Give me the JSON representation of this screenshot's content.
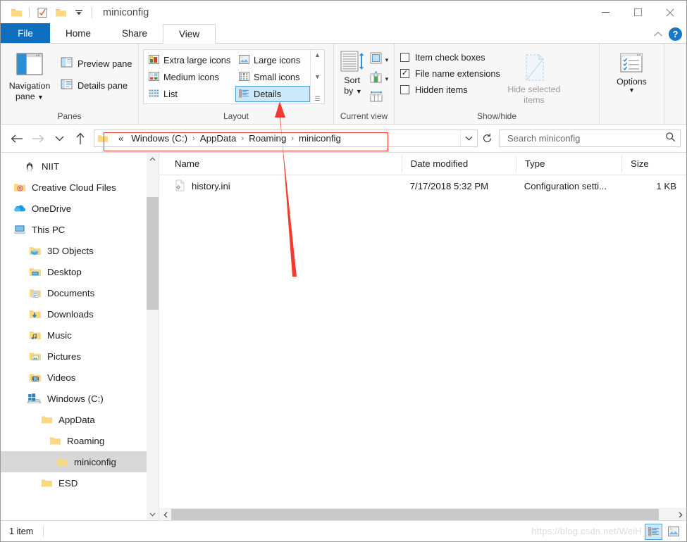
{
  "window": {
    "title": "miniconfig",
    "quick_access": [
      {
        "name": "folder-icon",
        "label": "Folder"
      },
      {
        "name": "properties-icon",
        "label": "Properties"
      },
      {
        "name": "new-folder-icon",
        "label": "New folder"
      },
      {
        "name": "customize-qat-icon",
        "label": "Customize Quick Access Toolbar"
      }
    ],
    "controls": {
      "minimize": "Minimize",
      "maximize": "Maximize",
      "close": "Close"
    }
  },
  "tabs": [
    {
      "label": "File",
      "active": false
    },
    {
      "label": "Home",
      "active": false
    },
    {
      "label": "Share",
      "active": false
    },
    {
      "label": "View",
      "active": true
    }
  ],
  "ribbon_tools": {
    "collapse_label": "Collapse the Ribbon",
    "help_label": "?"
  },
  "ribbon": {
    "panes": {
      "group_label": "Panes",
      "navigation_pane": "Navigation\npane",
      "navigation_pane_line1": "Navigation",
      "navigation_pane_line2": "pane",
      "preview_pane": "Preview pane",
      "details_pane": "Details pane"
    },
    "layout": {
      "group_label": "Layout",
      "options": [
        {
          "label": "Extra large icons",
          "selected": false
        },
        {
          "label": "Large icons",
          "selected": false
        },
        {
          "label": "Medium icons",
          "selected": false
        },
        {
          "label": "Small icons",
          "selected": false
        },
        {
          "label": "List",
          "selected": false
        },
        {
          "label": "Details",
          "selected": true
        }
      ]
    },
    "current_view": {
      "group_label": "Current view",
      "sort_by_line1": "Sort",
      "sort_by_line2": "by",
      "group_by": "Group by",
      "add_columns": "Add columns",
      "size_all_columns": "Size all columns to fit"
    },
    "show_hide": {
      "group_label": "Show/hide",
      "checkboxes": [
        {
          "label": "Item check boxes",
          "checked": false
        },
        {
          "label": "File name extensions",
          "checked": true
        },
        {
          "label": "Hidden items",
          "checked": false
        }
      ],
      "hide_selected_line1": "Hide selected",
      "hide_selected_line2": "items"
    },
    "options": {
      "group_label": "",
      "label": "Options"
    }
  },
  "address": {
    "back": "Back",
    "forward": "Forward",
    "recent": "Recent locations",
    "up": "Up",
    "overflow": "«",
    "crumbs": [
      "Windows (C:)",
      "AppData",
      "Roaming",
      "miniconfig"
    ],
    "separator": "›",
    "dropdown": "Previous locations",
    "refresh": "Refresh",
    "search_placeholder": "Search miniconfig",
    "search_value": ""
  },
  "sidebar": {
    "items": [
      {
        "label": "NIIT",
        "icon": "linux-penguin-icon",
        "indent": 0,
        "selected": false
      },
      {
        "label": "Creative Cloud Files",
        "icon": "creative-cloud-folder-icon",
        "indent": 0,
        "selected": false
      },
      {
        "label": "OneDrive",
        "icon": "onedrive-cloud-icon",
        "indent": 0,
        "selected": false
      },
      {
        "label": "This PC",
        "icon": "this-pc-icon",
        "indent": 0,
        "selected": false
      },
      {
        "label": "3D Objects",
        "icon": "3d-objects-folder-icon",
        "indent": 1,
        "selected": false
      },
      {
        "label": "Desktop",
        "icon": "desktop-folder-icon",
        "indent": 1,
        "selected": false
      },
      {
        "label": "Documents",
        "icon": "documents-folder-icon",
        "indent": 1,
        "selected": false
      },
      {
        "label": "Downloads",
        "icon": "downloads-folder-icon",
        "indent": 1,
        "selected": false
      },
      {
        "label": "Music",
        "icon": "music-folder-icon",
        "indent": 1,
        "selected": false
      },
      {
        "label": "Pictures",
        "icon": "pictures-folder-icon",
        "indent": 1,
        "selected": false
      },
      {
        "label": "Videos",
        "icon": "videos-folder-icon",
        "indent": 1,
        "selected": false
      },
      {
        "label": "Windows (C:)",
        "icon": "windows-drive-icon",
        "indent": 1,
        "selected": false
      },
      {
        "label": "AppData",
        "icon": "folder-icon",
        "indent": 2,
        "selected": false
      },
      {
        "label": "Roaming",
        "icon": "folder-icon",
        "indent": 3,
        "selected": false
      },
      {
        "label": "miniconfig",
        "icon": "folder-icon",
        "indent": 4,
        "selected": true
      },
      {
        "label": "ESD",
        "icon": "folder-icon",
        "indent": 2,
        "selected": false
      }
    ]
  },
  "file_list": {
    "columns": [
      "Name",
      "Date modified",
      "Type",
      "Size"
    ],
    "rows": [
      {
        "name": "history.ini",
        "icon": "configuration-file-icon",
        "date_modified": "7/17/2018 5:32 PM",
        "type": "Configuration setti...",
        "size": "1 KB"
      }
    ]
  },
  "status": {
    "item_count": "1 item",
    "watermark": "https://blog.csdn.net/WeiH",
    "view_buttons": [
      {
        "name": "details-view-button",
        "active": true
      },
      {
        "name": "large-icons-view-button",
        "active": false
      }
    ]
  }
}
